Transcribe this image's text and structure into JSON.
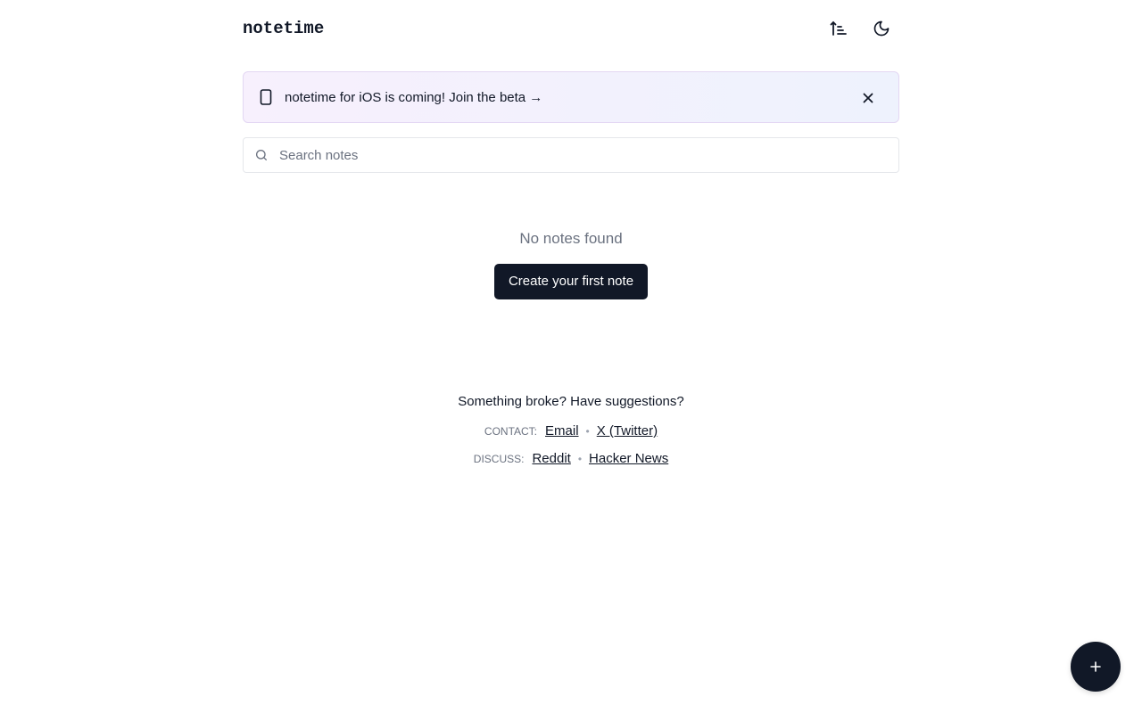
{
  "app": {
    "title": "notetime"
  },
  "header": {
    "sort_icon": "sort-ascending-icon",
    "theme_icon": "moon-icon"
  },
  "banner": {
    "icon": "phone-icon",
    "text": "notetime for iOS is coming! Join the beta →",
    "close_icon": "close-icon"
  },
  "search": {
    "icon": "search-icon",
    "placeholder": "Search notes",
    "value": ""
  },
  "empty_state": {
    "message": "No notes found",
    "button_label": "Create your first note"
  },
  "footer": {
    "question": "Something broke? Have suggestions?",
    "contact": {
      "label": "CONTACT:",
      "links": [
        "Email",
        "X (Twitter)"
      ]
    },
    "discuss": {
      "label": "DISCUSS:",
      "links": [
        "Reddit",
        "Hacker News"
      ]
    },
    "separator": "•"
  },
  "fab": {
    "icon": "plus-icon"
  },
  "colors": {
    "primary": "#111827",
    "muted": "#6b7280",
    "banner_border": "#e3d7f3"
  }
}
